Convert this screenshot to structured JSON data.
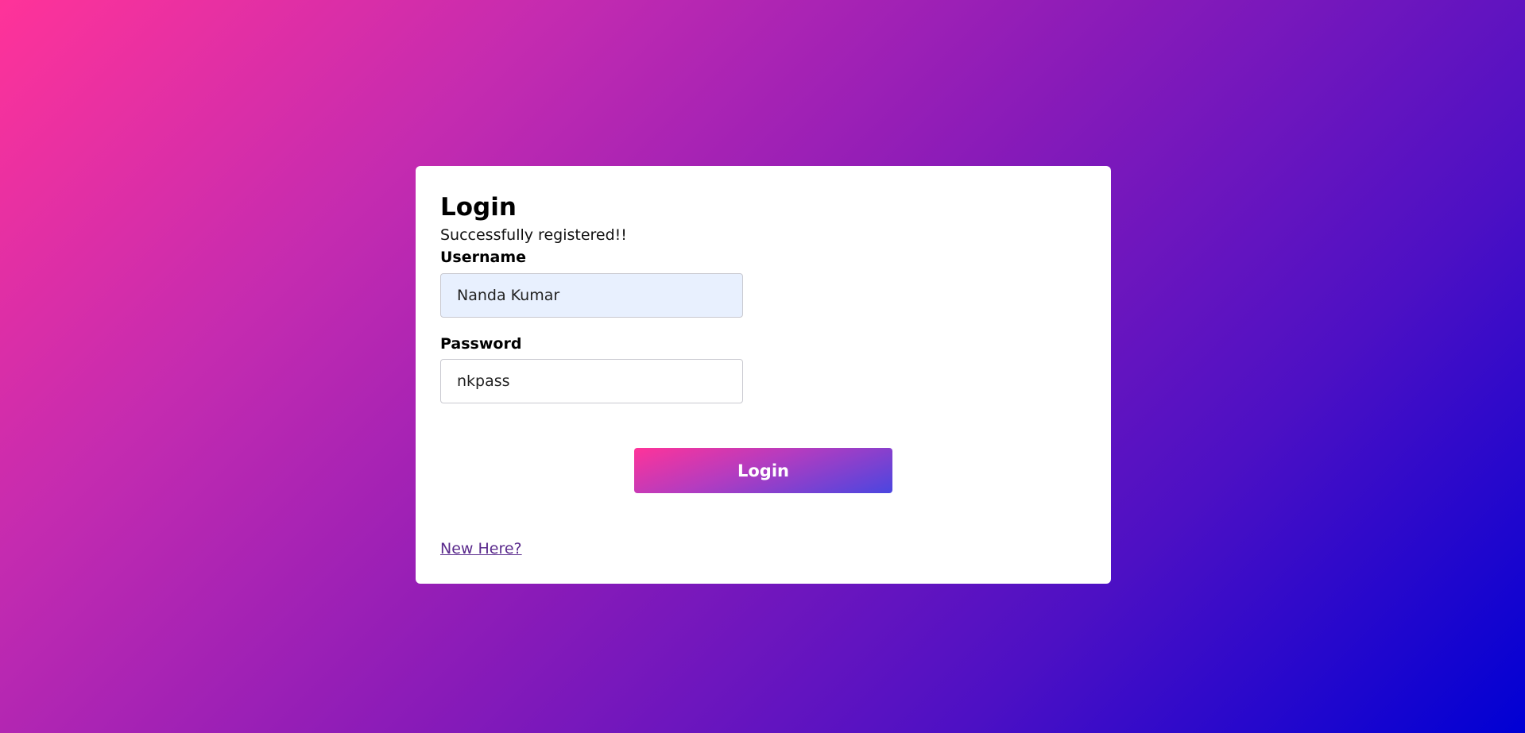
{
  "login_form": {
    "title": "Login",
    "status_message": "Successfully registered!!",
    "username_label": "Username",
    "username_value": "Nanda Kumar",
    "password_label": "Password",
    "password_value": "nkpass",
    "submit_label": "Login",
    "register_link": "New Here?"
  },
  "colors": {
    "gradient_start": "#ff3399",
    "gradient_end": "#0000d4",
    "card_background": "#ffffff",
    "autofill_background": "#e8f0fe",
    "link_color": "#5a2a8c"
  }
}
